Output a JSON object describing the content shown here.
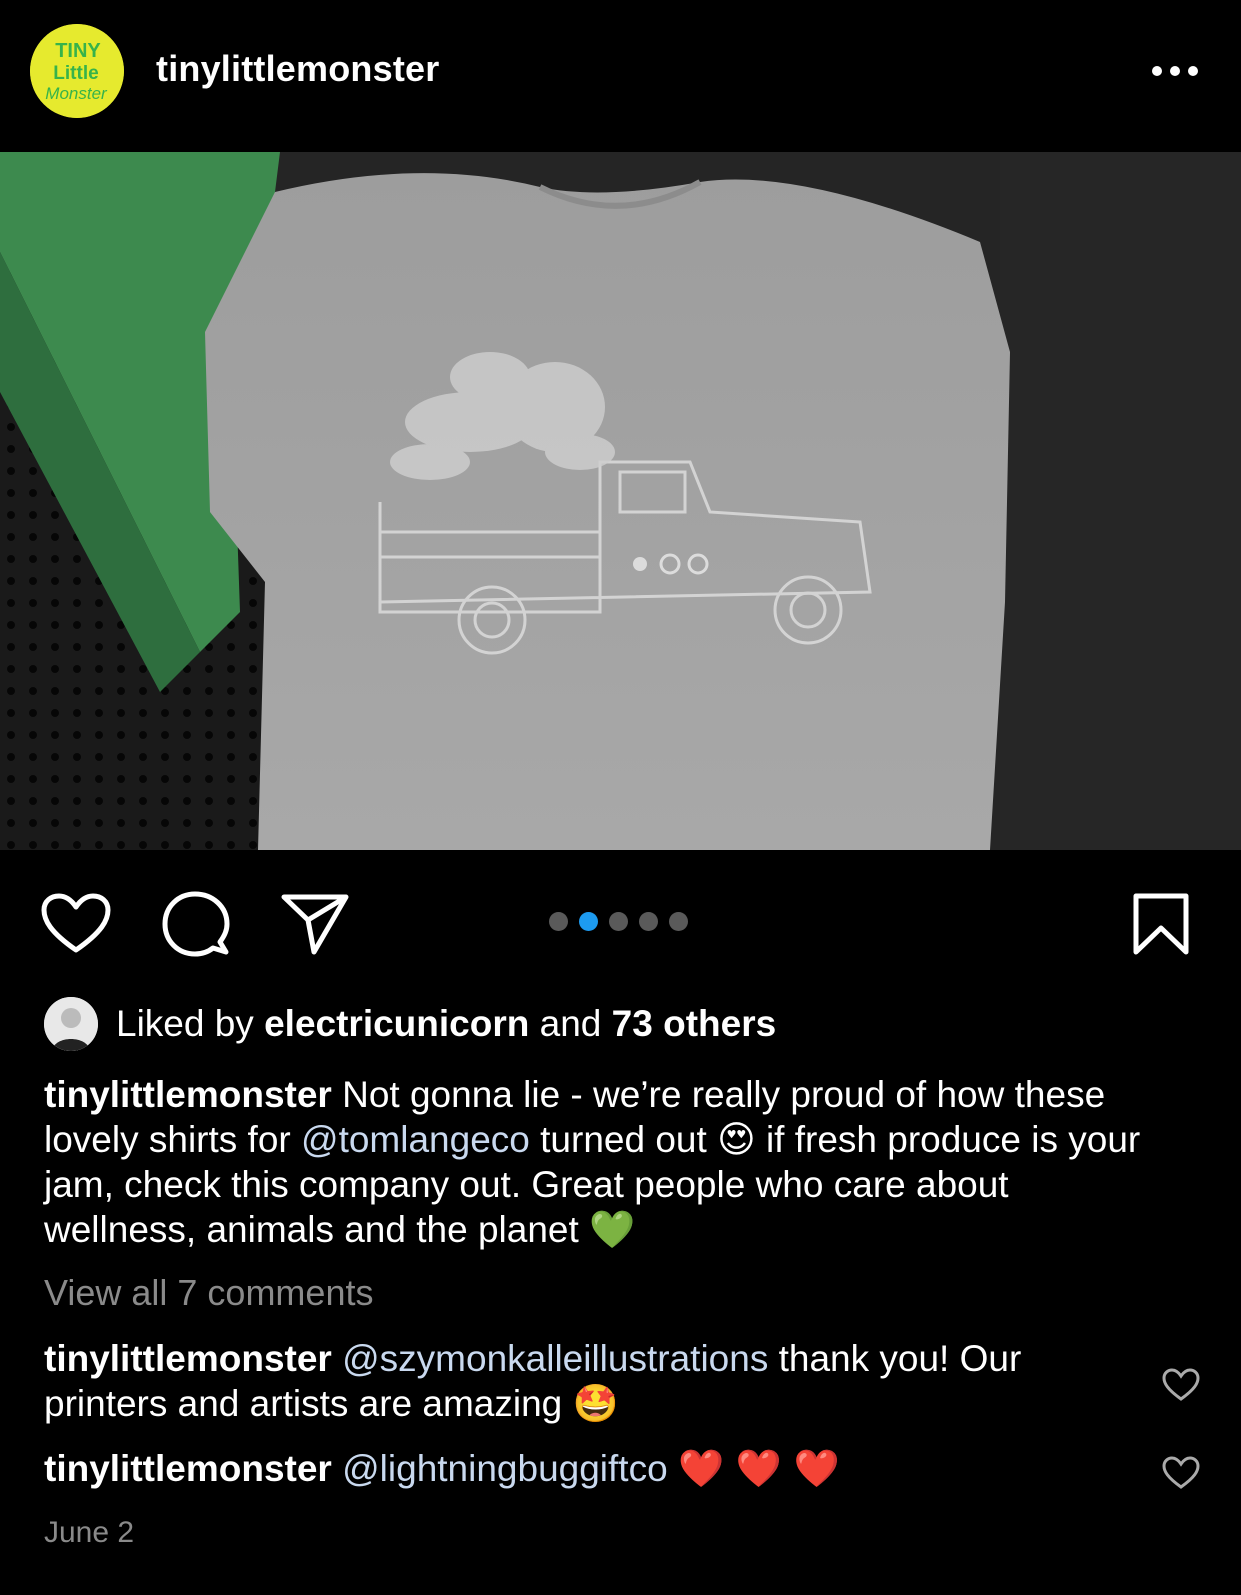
{
  "header": {
    "username": "tinylittlemonster",
    "avatar_logo_text": [
      "TINY",
      "Little",
      "Monster"
    ],
    "more_icon": "more-horizontal-icon"
  },
  "post": {
    "carousel": {
      "total": 5,
      "active_index": 1
    },
    "liked_by": {
      "prefix": "Liked by",
      "user": "electricunicorn",
      "and": "and",
      "others": "73 others"
    },
    "caption": {
      "author": "tinylittlemonster",
      "text_1": "Not gonna lie - we’re really proud of how these lovely shirts for",
      "mention": "@tomlangeco",
      "text_2": "turned out",
      "emoji_1": "😍",
      "text_3": "if fresh produce is your jam, check this company out. Great people who care about wellness, animals and the planet",
      "emoji_2": "💚"
    },
    "view_all_comments": "View all 7 comments",
    "comments": [
      {
        "author": "tinylittlemonster",
        "mention": "@szymonkalleillustrations",
        "text": "thank you! Our printers and artists are amazing",
        "emoji": "🤩"
      },
      {
        "author": "tinylittlemonster",
        "mention": "@lightningbuggiftco",
        "text": "",
        "emoji": "❤️ ❤️ ❤️"
      }
    ],
    "date": "June 2"
  },
  "colors": {
    "background": "#000000",
    "accent_blue": "#1d9bf0",
    "mention": "#c9d9ef",
    "muted": "#8a8a8a",
    "logo_yellow": "#e6ea2e",
    "logo_green": "#37b34a"
  }
}
